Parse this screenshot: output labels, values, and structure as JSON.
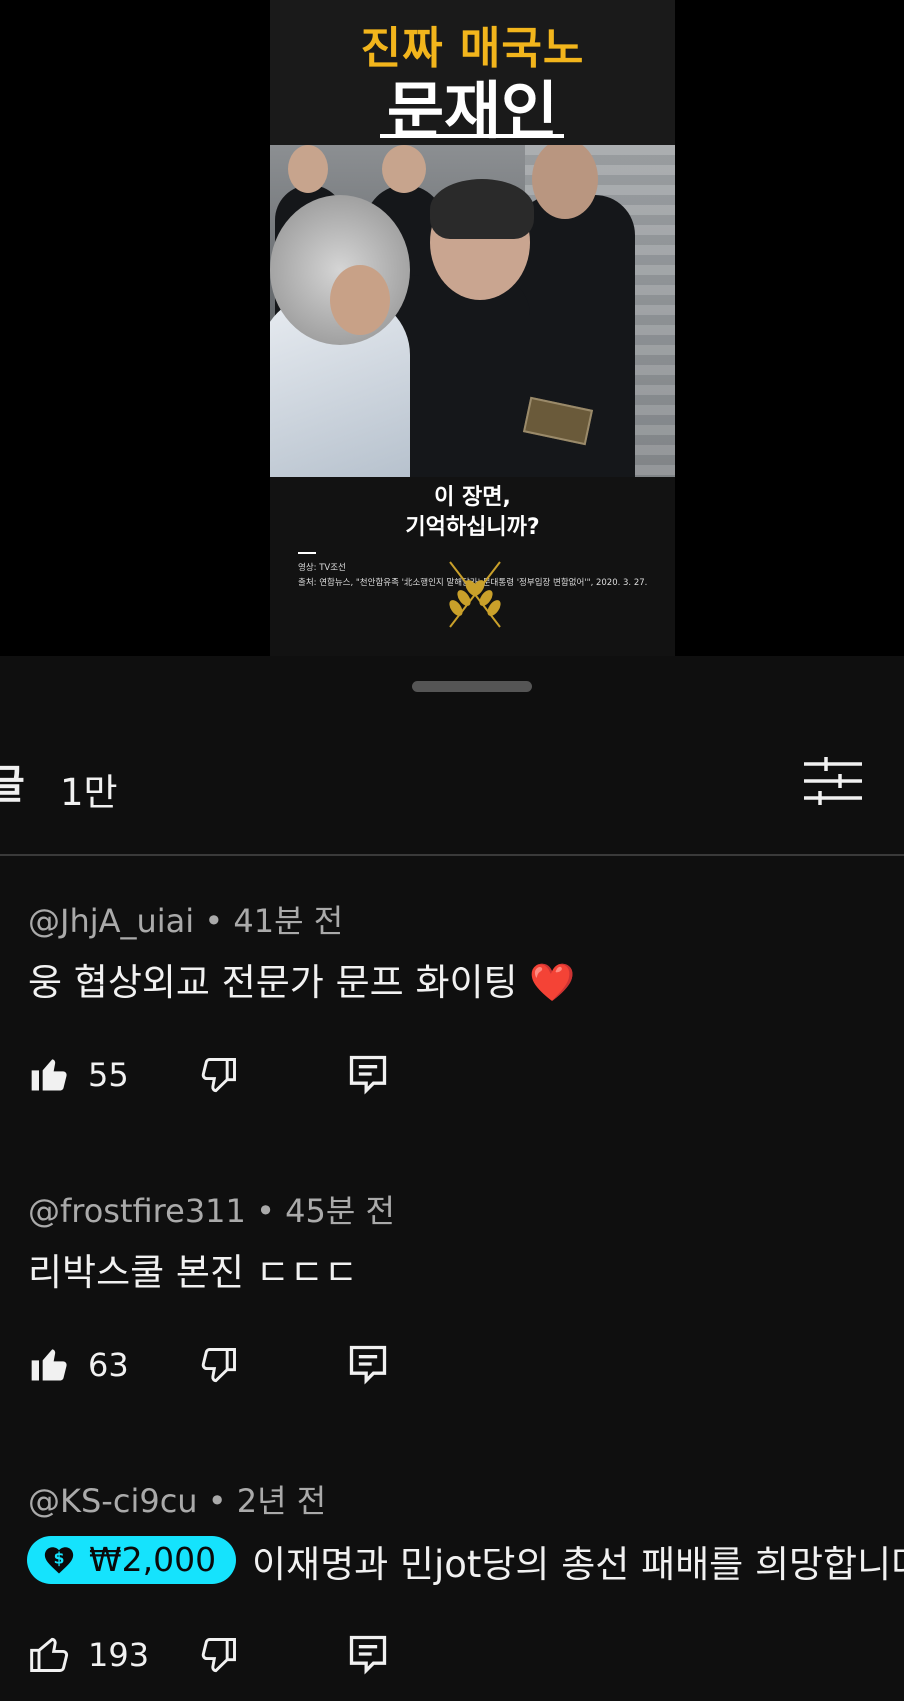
{
  "video": {
    "title_line1": "진짜 매국노",
    "title_line2": "문재인",
    "caption_line1": "이 장면,",
    "caption_line2": "기억하십니까?",
    "credit_video": "영상: TV조선",
    "credit_source": "출처: 연합뉴스, \"천안함유족 '北소행인지 말해달라' 문대통령 '정부입장 변함없어'\", 2020. 3. 27."
  },
  "comments_header": {
    "title": "글",
    "count": "1만"
  },
  "comments": [
    {
      "author": "@JhjA_uiai",
      "time": "41분 전",
      "text": "웅 협상외교 전문가 문프 화이팅 ❤️",
      "likes": "55",
      "liked": true
    },
    {
      "author": "@frostfire311",
      "time": "45분 전",
      "text": "리박스쿨 본진 ㄷㄷㄷ",
      "likes": "63",
      "liked": true
    },
    {
      "author": "@KS-ci9cu",
      "time": "2년 전",
      "thanks_amount": "₩2,000",
      "text": "이재명과 민jot당의 총선 패배를 희망합니다",
      "likes": "193",
      "liked": false
    }
  ],
  "colors": {
    "background": "#0f0f0f",
    "thanks_badge": "#15e3fd",
    "title_yellow": "#f2b51c",
    "meta_text": "#aaaaaa"
  },
  "icons": {
    "like": "thumbs-up-icon",
    "dislike": "thumbs-down-icon",
    "reply": "reply-icon",
    "filter": "filter-sliders-icon",
    "thanks": "super-thanks-icon"
  }
}
